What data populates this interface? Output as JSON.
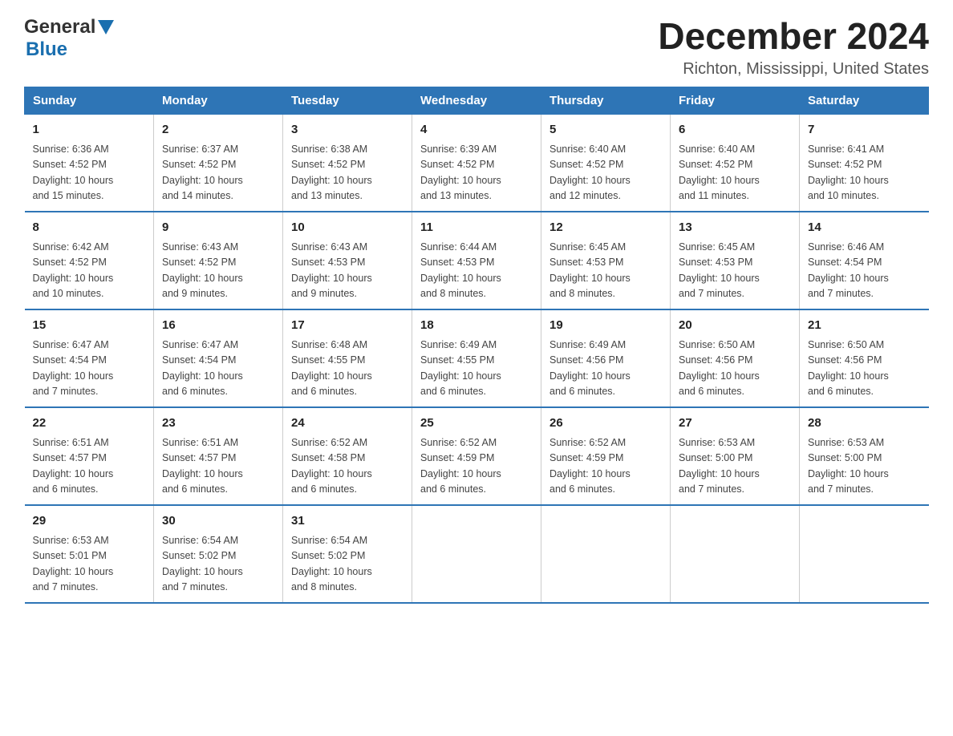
{
  "logo": {
    "general": "General",
    "blue": "Blue"
  },
  "title": "December 2024",
  "subtitle": "Richton, Mississippi, United States",
  "headers": [
    "Sunday",
    "Monday",
    "Tuesday",
    "Wednesday",
    "Thursday",
    "Friday",
    "Saturday"
  ],
  "weeks": [
    [
      {
        "day": "1",
        "sunrise": "6:36 AM",
        "sunset": "4:52 PM",
        "daylight": "10 hours and 15 minutes."
      },
      {
        "day": "2",
        "sunrise": "6:37 AM",
        "sunset": "4:52 PM",
        "daylight": "10 hours and 14 minutes."
      },
      {
        "day": "3",
        "sunrise": "6:38 AM",
        "sunset": "4:52 PM",
        "daylight": "10 hours and 13 minutes."
      },
      {
        "day": "4",
        "sunrise": "6:39 AM",
        "sunset": "4:52 PM",
        "daylight": "10 hours and 13 minutes."
      },
      {
        "day": "5",
        "sunrise": "6:40 AM",
        "sunset": "4:52 PM",
        "daylight": "10 hours and 12 minutes."
      },
      {
        "day": "6",
        "sunrise": "6:40 AM",
        "sunset": "4:52 PM",
        "daylight": "10 hours and 11 minutes."
      },
      {
        "day": "7",
        "sunrise": "6:41 AM",
        "sunset": "4:52 PM",
        "daylight": "10 hours and 10 minutes."
      }
    ],
    [
      {
        "day": "8",
        "sunrise": "6:42 AM",
        "sunset": "4:52 PM",
        "daylight": "10 hours and 10 minutes."
      },
      {
        "day": "9",
        "sunrise": "6:43 AM",
        "sunset": "4:52 PM",
        "daylight": "10 hours and 9 minutes."
      },
      {
        "day": "10",
        "sunrise": "6:43 AM",
        "sunset": "4:53 PM",
        "daylight": "10 hours and 9 minutes."
      },
      {
        "day": "11",
        "sunrise": "6:44 AM",
        "sunset": "4:53 PM",
        "daylight": "10 hours and 8 minutes."
      },
      {
        "day": "12",
        "sunrise": "6:45 AM",
        "sunset": "4:53 PM",
        "daylight": "10 hours and 8 minutes."
      },
      {
        "day": "13",
        "sunrise": "6:45 AM",
        "sunset": "4:53 PM",
        "daylight": "10 hours and 7 minutes."
      },
      {
        "day": "14",
        "sunrise": "6:46 AM",
        "sunset": "4:54 PM",
        "daylight": "10 hours and 7 minutes."
      }
    ],
    [
      {
        "day": "15",
        "sunrise": "6:47 AM",
        "sunset": "4:54 PM",
        "daylight": "10 hours and 7 minutes."
      },
      {
        "day": "16",
        "sunrise": "6:47 AM",
        "sunset": "4:54 PM",
        "daylight": "10 hours and 6 minutes."
      },
      {
        "day": "17",
        "sunrise": "6:48 AM",
        "sunset": "4:55 PM",
        "daylight": "10 hours and 6 minutes."
      },
      {
        "day": "18",
        "sunrise": "6:49 AM",
        "sunset": "4:55 PM",
        "daylight": "10 hours and 6 minutes."
      },
      {
        "day": "19",
        "sunrise": "6:49 AM",
        "sunset": "4:56 PM",
        "daylight": "10 hours and 6 minutes."
      },
      {
        "day": "20",
        "sunrise": "6:50 AM",
        "sunset": "4:56 PM",
        "daylight": "10 hours and 6 minutes."
      },
      {
        "day": "21",
        "sunrise": "6:50 AM",
        "sunset": "4:56 PM",
        "daylight": "10 hours and 6 minutes."
      }
    ],
    [
      {
        "day": "22",
        "sunrise": "6:51 AM",
        "sunset": "4:57 PM",
        "daylight": "10 hours and 6 minutes."
      },
      {
        "day": "23",
        "sunrise": "6:51 AM",
        "sunset": "4:57 PM",
        "daylight": "10 hours and 6 minutes."
      },
      {
        "day": "24",
        "sunrise": "6:52 AM",
        "sunset": "4:58 PM",
        "daylight": "10 hours and 6 minutes."
      },
      {
        "day": "25",
        "sunrise": "6:52 AM",
        "sunset": "4:59 PM",
        "daylight": "10 hours and 6 minutes."
      },
      {
        "day": "26",
        "sunrise": "6:52 AM",
        "sunset": "4:59 PM",
        "daylight": "10 hours and 6 minutes."
      },
      {
        "day": "27",
        "sunrise": "6:53 AM",
        "sunset": "5:00 PM",
        "daylight": "10 hours and 7 minutes."
      },
      {
        "day": "28",
        "sunrise": "6:53 AM",
        "sunset": "5:00 PM",
        "daylight": "10 hours and 7 minutes."
      }
    ],
    [
      {
        "day": "29",
        "sunrise": "6:53 AM",
        "sunset": "5:01 PM",
        "daylight": "10 hours and 7 minutes."
      },
      {
        "day": "30",
        "sunrise": "6:54 AM",
        "sunset": "5:02 PM",
        "daylight": "10 hours and 7 minutes."
      },
      {
        "day": "31",
        "sunrise": "6:54 AM",
        "sunset": "5:02 PM",
        "daylight": "10 hours and 8 minutes."
      },
      null,
      null,
      null,
      null
    ]
  ],
  "labels": {
    "sunrise": "Sunrise:",
    "sunset": "Sunset:",
    "daylight": "Daylight:"
  }
}
